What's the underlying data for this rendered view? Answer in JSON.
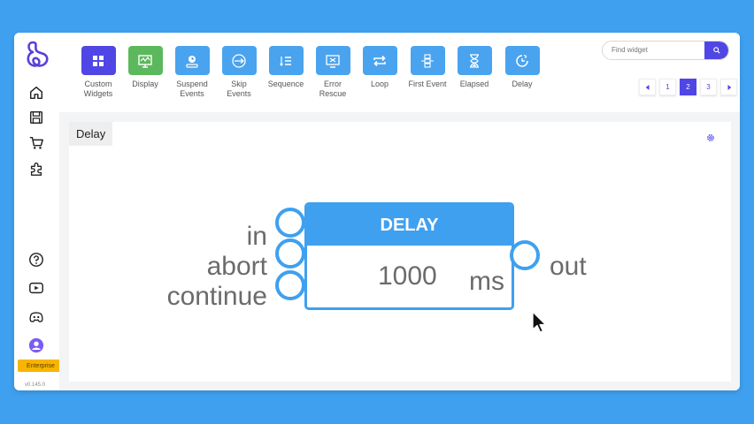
{
  "toolbar": {
    "tools": [
      {
        "label": "Custom\nWidgets",
        "icon": "grid-icon",
        "color": "#4f46e5"
      },
      {
        "label": "Display",
        "icon": "monitor-icon",
        "color": "#5cb85c"
      },
      {
        "label": "Suspend\nEvents",
        "icon": "suspend-icon",
        "color": "#4aa3ee"
      },
      {
        "label": "Skip\nEvents",
        "icon": "skip-icon",
        "color": "#4aa3ee"
      },
      {
        "label": "Sequence",
        "icon": "sequence-icon",
        "color": "#4aa3ee"
      },
      {
        "label": "Error\nRescue",
        "icon": "error-rescue-icon",
        "color": "#4aa3ee"
      },
      {
        "label": "Loop",
        "icon": "loop-icon",
        "color": "#4aa3ee"
      },
      {
        "label": "First Event",
        "icon": "first-event-icon",
        "color": "#4aa3ee"
      },
      {
        "label": "Elapsed",
        "icon": "hourglass-icon",
        "color": "#4aa3ee"
      },
      {
        "label": "Delay",
        "icon": "clock-icon",
        "color": "#4aa3ee"
      }
    ],
    "search_placeholder": "Find widget",
    "pages": [
      "1",
      "2",
      "3"
    ],
    "active_page": "2"
  },
  "sidebar": {
    "badge": "Enterprise",
    "version": "v0.145.0"
  },
  "panel": {
    "title": "Delay"
  },
  "node": {
    "title": "DELAY",
    "value": "1000",
    "unit": "ms",
    "inputs": [
      "in",
      "abort",
      "continue"
    ],
    "outputs": [
      "out"
    ]
  },
  "colors": {
    "accent": "#3fa0f0",
    "brand": "#4f46e5"
  }
}
